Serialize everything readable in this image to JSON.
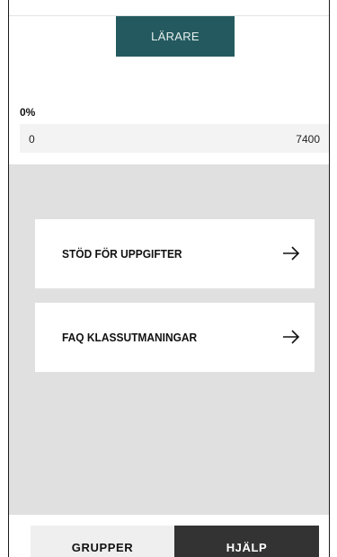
{
  "header": {
    "role_button_label": "LÄRARE"
  },
  "progress": {
    "percent_label": "0%",
    "min_label": "0",
    "max_label": "7400",
    "fill_fraction": 0
  },
  "cards": [
    {
      "label": "STÖD FÖR UPPGIFTER",
      "icon": "arrow-right-icon"
    },
    {
      "label": "FAQ KLASSUTMANINGAR",
      "icon": "arrow-right-icon"
    }
  ],
  "bottom_nav": {
    "tabs": [
      {
        "label": "GRUPPER",
        "active": false
      },
      {
        "label": "HJÄLP",
        "active": true
      }
    ]
  },
  "colors": {
    "accent": "#245a5f",
    "panel_bg": "#e0e0e0",
    "active_tab_bg": "#333333"
  }
}
